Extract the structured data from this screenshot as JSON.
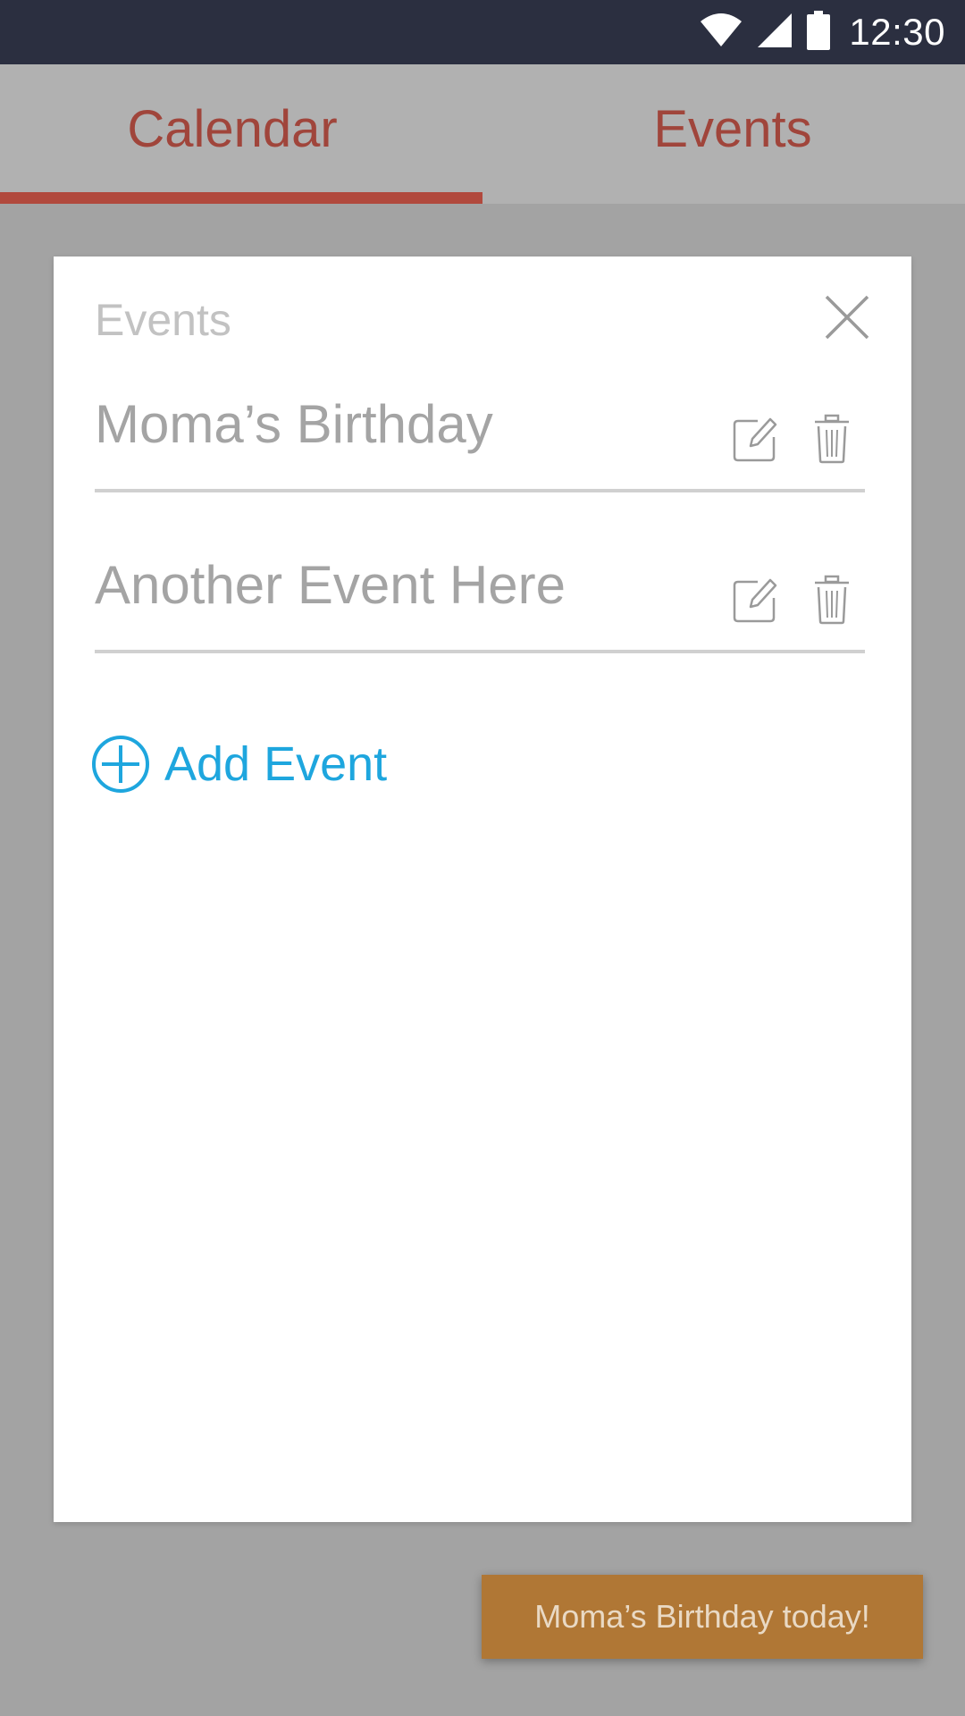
{
  "status_bar": {
    "time": "12:30",
    "icons": [
      "wifi-icon",
      "cell-signal-icon",
      "battery-icon"
    ]
  },
  "tabs": [
    {
      "label": "Calendar",
      "active": true
    },
    {
      "label": "Events",
      "active": false
    }
  ],
  "dialog": {
    "title": "Events",
    "close_icon": "close-icon",
    "events": [
      {
        "name": "Moma’s Birthday"
      },
      {
        "name": "Another Event Here"
      }
    ],
    "add_label": "Add Event"
  },
  "toast": {
    "message": "Moma’s Birthday today!"
  },
  "colors": {
    "status_bar": "#2b2f40",
    "tab_bar": "#b1b1b1",
    "accent_red": "#b1493d",
    "tab_text": "#a0453b",
    "add_blue": "#1ea6de",
    "toast": "#b07735",
    "scrim": "#a3a3a3"
  }
}
